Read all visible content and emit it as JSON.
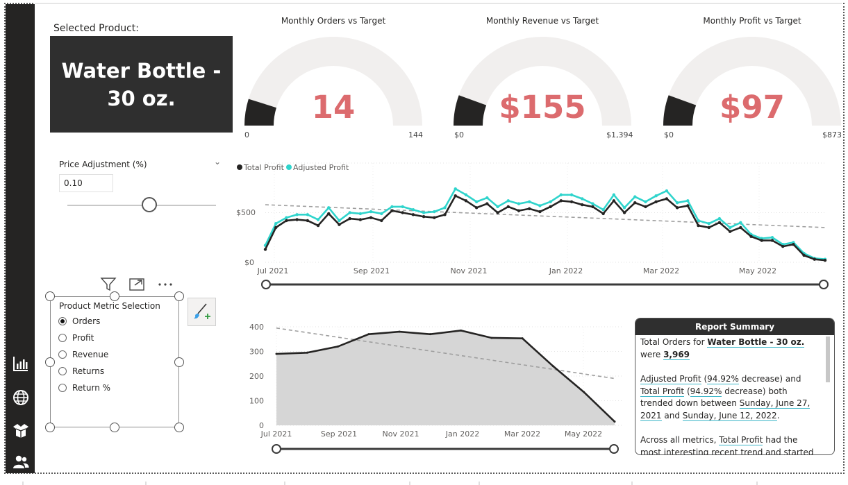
{
  "colors": {
    "accent_red": "#dc6b6e",
    "dark": "#252423",
    "card_bg": "#2f2f2f",
    "teal": "#2fd4cc",
    "gauge_bg": "#f1efee"
  },
  "sidebar": {
    "icons": [
      "bar-chart-icon",
      "globe-icon",
      "box-icon",
      "users-icon"
    ]
  },
  "product": {
    "label": "Selected Product:",
    "name": "Water Bottle - 30 oz."
  },
  "gauges": [
    {
      "title": "Monthly Orders vs Target",
      "value": "14",
      "min": "0",
      "max": "144",
      "fill_fraction": 0.097
    },
    {
      "title": "Monthly Revenue vs Target",
      "value": "$155",
      "min": "$0",
      "max": "$1,394",
      "fill_fraction": 0.111
    },
    {
      "title": "Monthly Profit vs Target",
      "value": "$97",
      "min": "$0",
      "max": "$873",
      "fill_fraction": 0.111
    }
  ],
  "price_adjustment": {
    "title": "Price Adjustment (%)",
    "value": "0.10",
    "slider_fraction": 0.55
  },
  "metric_selection": {
    "title": "Product Metric Selection",
    "options": [
      {
        "label": "Orders",
        "selected": true
      },
      {
        "label": "Profit",
        "selected": false
      },
      {
        "label": "Revenue",
        "selected": false
      },
      {
        "label": "Returns",
        "selected": false
      },
      {
        "label": "Return %",
        "selected": false
      }
    ]
  },
  "chart_data": [
    {
      "type": "line",
      "legend": "top-left",
      "series_names": [
        "Total Profit",
        "Adjusted Profit"
      ],
      "x_ticks": [
        "Jul 2021",
        "Sep 2021",
        "Nov 2021",
        "Jan 2022",
        "Mar 2022",
        "May 2022"
      ],
      "y_ticks": [
        "$0",
        "$500"
      ],
      "ylim": [
        0,
        1000
      ],
      "series": [
        {
          "name": "Total Profit",
          "color": "#252423",
          "values": [
            130,
            350,
            420,
            430,
            420,
            370,
            490,
            380,
            440,
            430,
            450,
            420,
            520,
            500,
            480,
            460,
            450,
            480,
            670,
            620,
            550,
            590,
            500,
            560,
            520,
            540,
            510,
            560,
            620,
            610,
            580,
            560,
            490,
            620,
            500,
            600,
            560,
            610,
            640,
            550,
            570,
            370,
            350,
            400,
            310,
            350,
            260,
            220,
            220,
            160,
            180,
            70,
            30,
            20
          ]
        },
        {
          "name": "Adjusted Profit",
          "color": "#2fd4cc",
          "values": [
            170,
            390,
            450,
            480,
            480,
            430,
            550,
            420,
            500,
            490,
            510,
            490,
            560,
            560,
            530,
            500,
            510,
            550,
            740,
            680,
            610,
            650,
            560,
            620,
            590,
            610,
            570,
            610,
            680,
            680,
            640,
            590,
            530,
            680,
            550,
            660,
            610,
            670,
            720,
            600,
            620,
            420,
            390,
            440,
            350,
            400,
            280,
            240,
            250,
            180,
            200,
            90,
            40,
            30
          ]
        }
      ],
      "trend": [
        [
          0,
          580
        ],
        [
          53,
          350
        ]
      ]
    },
    {
      "type": "area",
      "x_ticks": [
        "Jul 2021",
        "Sep 2021",
        "Nov 2021",
        "Jan 2022",
        "Mar 2022",
        "May 2022"
      ],
      "y_ticks": [
        "0",
        "100",
        "200",
        "300",
        "400"
      ],
      "ylim": [
        0,
        400
      ],
      "values": [
        290,
        295,
        320,
        370,
        380,
        370,
        385,
        355,
        353,
        240,
        135,
        15
      ],
      "trend": [
        [
          0,
          395
        ],
        [
          11,
          190
        ]
      ]
    }
  ],
  "summary": {
    "title": "Report Summary",
    "p1_pre": "Total Orders for ",
    "p1_product": "Water Bottle - 30 oz.",
    "p1_mid": " were ",
    "p1_value": "3,969",
    "p2_m1": "Adjusted Profit",
    "p2_t1": " (",
    "p2_pct1": "94.92%",
    "p2_t2": " decrease) and ",
    "p2_m2": "Total Profit",
    "p2_t3": " (",
    "p2_pct2": "94.92%",
    "p2_t4": " decrease) both trended down between ",
    "p2_d1": "Sunday, June 27, 2021",
    "p2_t5": " and ",
    "p2_d2": "Sunday, June 12, 2022",
    "p2_t6": ".",
    "p3_pre": "Across all metrics, ",
    "p3_m": "Total Profit",
    "p3_post": " had the most interesting recent trend and started trending"
  }
}
